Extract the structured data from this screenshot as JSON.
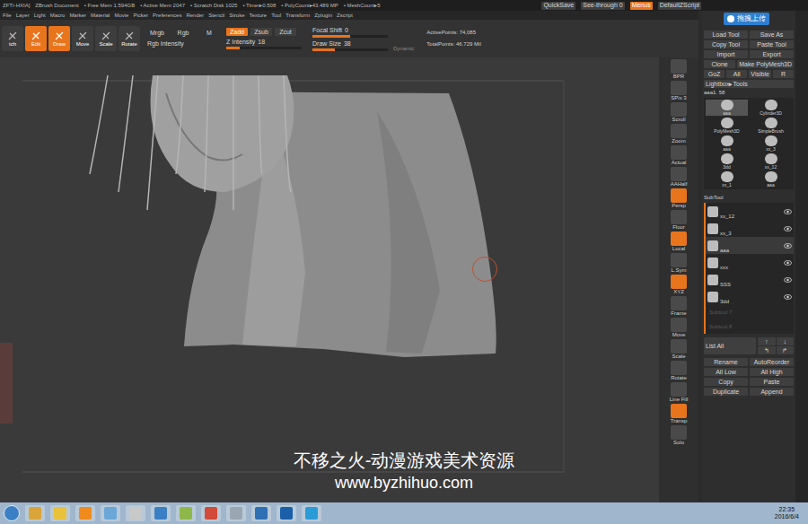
{
  "title_bar": {
    "items": [
      "ZFTI-HXIA]",
      "ZBrush Document",
      "• Free Mem 1.594GB",
      "• Active Mem 2047",
      "• Scratch Disk 1025",
      "• Timer▸0.508",
      "• PolyCount▸43.489 MP",
      "• MeshCount▸5"
    ],
    "right": [
      {
        "label": "QuickSave",
        "selected": false
      },
      {
        "label": "See-through 0",
        "selected": false
      },
      {
        "label": "Menus",
        "selected": true
      },
      {
        "label": "DefaultZScript",
        "selected": false
      }
    ]
  },
  "upload_badge": "拖拽上传",
  "menu_bar": [
    "File",
    "Layer",
    "Light",
    "Macro",
    "Marker",
    "Material",
    "Movie",
    "Picker",
    "Preferences",
    "Render",
    "Stencil",
    "Stroke",
    "Texture",
    "Tool",
    "Transform",
    "Zplugin",
    "Zscript"
  ],
  "toolbar": {
    "tools": [
      {
        "label": "tch",
        "selected": false
      },
      {
        "label": "Edit",
        "selected": true
      },
      {
        "label": "Draw",
        "selected": true
      },
      {
        "label": "Move",
        "selected": false
      },
      {
        "label": "Scale",
        "selected": false
      },
      {
        "label": "Rotate",
        "selected": false
      }
    ],
    "channels": [
      {
        "label": "Mrgb",
        "selected": false
      },
      {
        "label": "Rgb",
        "selected": false
      },
      {
        "label": "M",
        "selected": false
      }
    ],
    "rgb_intensity": {
      "label": "Rgb Intensity",
      "disabled": true
    },
    "z_modes": [
      {
        "label": "Zadd",
        "selected": true,
        "disabled": false
      },
      {
        "label": "Zsub",
        "selected": false,
        "disabled": false
      },
      {
        "label": "Zcut",
        "selected": false,
        "disabled": true
      }
    ],
    "z_intensity": {
      "label": "Z Intensity",
      "value": "18",
      "level": 0.18
    },
    "sliders": [
      {
        "label": "Focal Shift",
        "value": "0",
        "level": 0.5
      },
      {
        "label": "Draw Size",
        "value": "38",
        "level": 0.3
      }
    ],
    "dynamic": "Dynamic",
    "stats": [
      "ActivePoints: 74,085",
      "TotalPoints: 46.729 Mil"
    ]
  },
  "shelf": [
    {
      "label": "BPR",
      "selected": false
    },
    {
      "label": "SPix 3",
      "selected": false
    },
    {
      "label": "Scroll",
      "selected": false
    },
    {
      "label": "Zoom",
      "selected": false
    },
    {
      "label": "Actual",
      "selected": false
    },
    {
      "label": "AAHalf",
      "selected": false
    },
    {
      "label": "Persp",
      "selected": true
    },
    {
      "label": "Floor",
      "selected": false
    },
    {
      "label": "Local",
      "selected": true
    },
    {
      "label": "L.Sym",
      "selected": false
    },
    {
      "label": "XYZ",
      "selected": true
    },
    {
      "label": "Frame",
      "selected": false
    },
    {
      "label": "Move",
      "selected": false
    },
    {
      "label": "Scale",
      "selected": false
    },
    {
      "label": "Rotate",
      "selected": false
    },
    {
      "label": "Line Fill",
      "selected": false
    },
    {
      "label": "Transp",
      "selected": true
    },
    {
      "label": "Solo",
      "selected": false
    }
  ],
  "right_panel": {
    "tool_buttons": [
      {
        "label": "Load Tool",
        "disabled": false
      },
      {
        "label": "Save As",
        "disabled": false
      },
      {
        "label": "Copy Tool",
        "disabled": false
      },
      {
        "label": "Paste Tool",
        "disabled": true
      },
      {
        "label": "Import",
        "disabled": false
      },
      {
        "label": "Export",
        "disabled": false
      }
    ],
    "tool_row": [
      "Clone",
      "Make PolyMesh3D"
    ],
    "goz_row": [
      "GoZ",
      "All",
      "Visible",
      "R"
    ],
    "lightbox": "Lightbox▸Tools",
    "current_tool": "aaa1. 58",
    "thumbnails": [
      {
        "label": "aaa",
        "selected": true
      },
      {
        "label": "Cylinder3D",
        "selected": false
      },
      {
        "label": "PolyMesh3D",
        "selected": false
      },
      {
        "label": "SimpleBrush",
        "selected": false
      },
      {
        "label": "aaa",
        "selected": false
      },
      {
        "label": "xx_3",
        "selected": false
      },
      {
        "label": "3dd",
        "selected": false
      },
      {
        "label": "xx_12",
        "selected": false
      },
      {
        "label": "xx_1",
        "selected": false
      },
      {
        "label": "aaa",
        "selected": false
      }
    ],
    "subtool_title": "SubTool",
    "subtools": [
      {
        "name": "xx_12",
        "visible": true,
        "selected": false
      },
      {
        "name": "xx_3",
        "visible": true,
        "selected": false
      },
      {
        "name": "aaa",
        "visible": true,
        "selected": true
      },
      {
        "name": "xxx",
        "visible": true,
        "selected": false
      },
      {
        "name": "SSS",
        "visible": true,
        "selected": false
      },
      {
        "name": "3dd",
        "visible": true,
        "selected": false
      }
    ],
    "empty_slots": [
      "Subtool 7",
      "Subtool 8"
    ],
    "list_all": "List All",
    "arrows": [
      "↑",
      "↓",
      "↰",
      "↱"
    ],
    "bottom_buttons": [
      {
        "label": "Rename",
        "disabled": false
      },
      {
        "label": "AutoReorder",
        "disabled": false
      },
      {
        "label": "All Low",
        "disabled": false
      },
      {
        "label": "All High",
        "disabled": false
      },
      {
        "label": "Copy",
        "disabled": false
      },
      {
        "label": "Paste",
        "disabled": true
      },
      {
        "label": "Duplicate",
        "disabled": false
      },
      {
        "label": "Append",
        "disabled": false
      }
    ]
  },
  "watermark": {
    "title": "不移之火-动漫游戏美术资源",
    "url": "www.byzhihuo.com"
  },
  "taskbar": {
    "apps": [
      {
        "color": "#d9a53a"
      },
      {
        "color": "#e8c23a"
      },
      {
        "color": "#f08a1c"
      },
      {
        "color": "#6aa7d8"
      },
      {
        "color": "#c9c9c9"
      },
      {
        "color": "#3b7fc4"
      },
      {
        "color": "#8fb84a"
      },
      {
        "color": "#d14a3a"
      },
      {
        "color": "#9aa6b2"
      },
      {
        "color": "#2f6fb4"
      },
      {
        "color": "#1b5fa8"
      },
      {
        "color": "#2b9bd8"
      }
    ],
    "time": "22:35",
    "date": "2016/6/4"
  }
}
